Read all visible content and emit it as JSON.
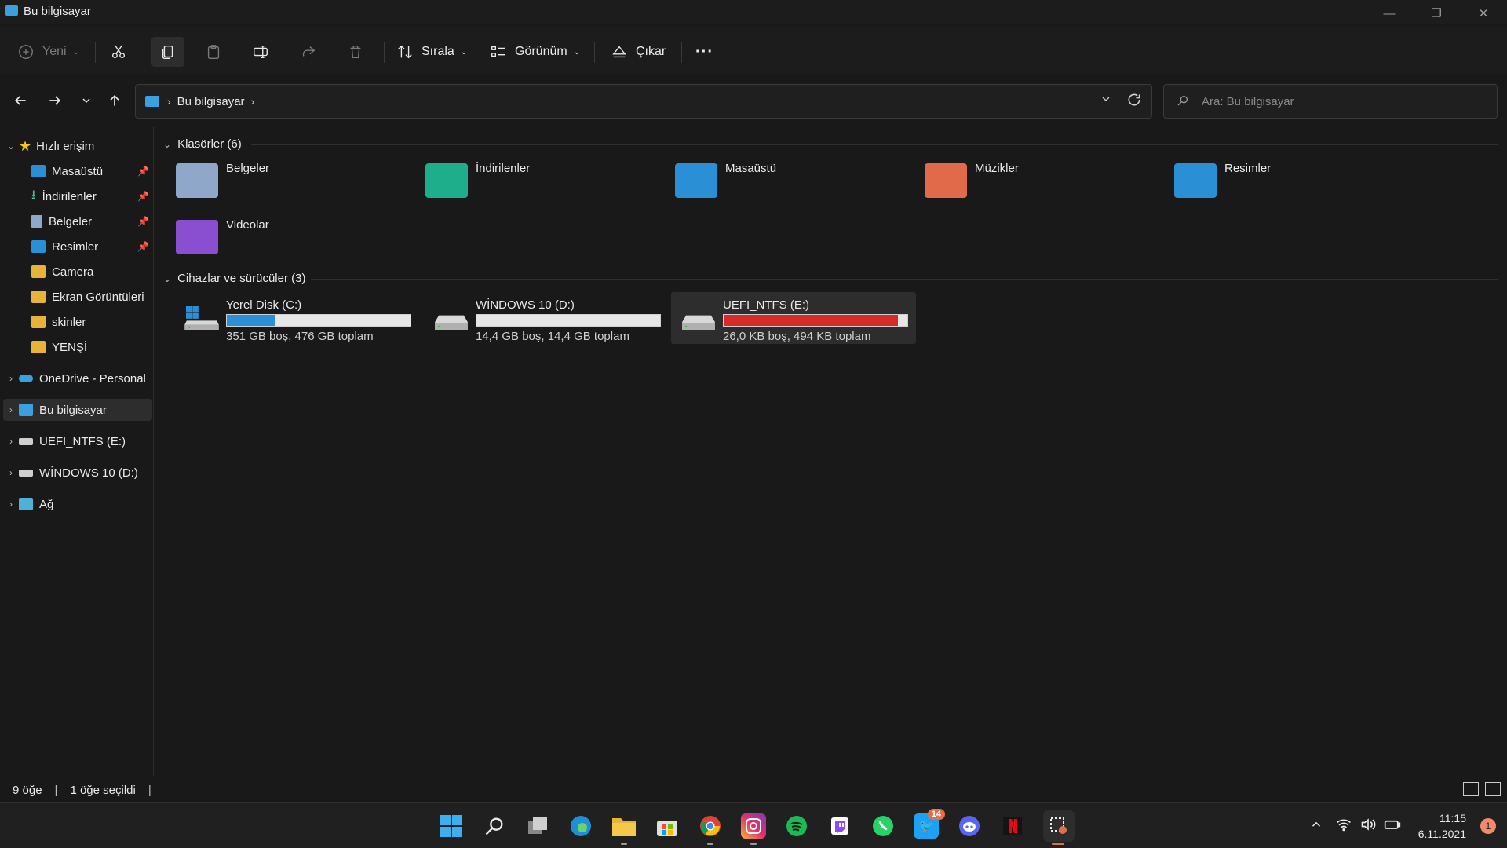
{
  "window": {
    "title": "Bu bilgisayar"
  },
  "window_controls": {
    "minimize": "—",
    "maximize": "❐",
    "close": "✕"
  },
  "toolbar": {
    "new_label": "Yeni",
    "sort_label": "Sırala",
    "view_label": "Görünüm",
    "eject_label": "Çıkar",
    "more_label": "···"
  },
  "address": {
    "crumb": "Bu bilgisayar",
    "search_placeholder": "Ara: Bu bilgisayar"
  },
  "sidebar": {
    "quick_access": "Hızlı erişim",
    "items": [
      {
        "label": "Masaüstü",
        "pinned": true
      },
      {
        "label": "İndirilenler",
        "pinned": true
      },
      {
        "label": "Belgeler",
        "pinned": true
      },
      {
        "label": "Resimler",
        "pinned": true
      },
      {
        "label": "Camera",
        "pinned": false
      },
      {
        "label": "Ekran Görüntüleri",
        "pinned": false
      },
      {
        "label": "skinler",
        "pinned": false
      },
      {
        "label": "YENŞİ",
        "pinned": false
      }
    ],
    "onedrive": "OneDrive - Personal",
    "this_pc": "Bu bilgisayar",
    "uefi": "UEFI_NTFS (E:)",
    "windows10": "WİNDOWS 10 (D:)",
    "network": "Ağ"
  },
  "folders_section": "Klasörler (6)",
  "folders": [
    {
      "name": "Belgeler",
      "icon": "documents-folder-icon",
      "color": "#8fa7c9"
    },
    {
      "name": "İndirilenler",
      "icon": "downloads-folder-icon",
      "color": "#1fae8c"
    },
    {
      "name": "Masaüstü",
      "icon": "desktop-folder-icon",
      "color": "#2b8fd6"
    },
    {
      "name": "Müzikler",
      "icon": "music-folder-icon",
      "color": "#e06a4a"
    },
    {
      "name": "Resimler",
      "icon": "pictures-folder-icon",
      "color": "#2b8fd6"
    },
    {
      "name": "Videolar",
      "icon": "videos-folder-icon",
      "color": "#8a4fd0"
    }
  ],
  "drives_section": "Cihazlar ve sürücüler (3)",
  "drives": [
    {
      "name": "Yerel Disk (C:)",
      "info": "351 GB boş, 476 GB toplam",
      "used_fraction": 0.26,
      "color": "#2b8fd6"
    },
    {
      "name": "WİNDOWS 10 (D:)",
      "info": "14,4 GB boş, 14,4 GB toplam",
      "used_fraction": 0.0,
      "color": "#2b8fd6"
    },
    {
      "name": "UEFI_NTFS (E:)",
      "info": "26,0 KB boş, 494 KB toplam",
      "used_fraction": 0.95,
      "color": "#d92a2a"
    }
  ],
  "status": {
    "items": "9 öğe",
    "selected": "1 öğe seçildi",
    "sep": "|"
  },
  "taskbar": {
    "twitter_badge": "14",
    "time": "11:15",
    "date": "6.11.2021",
    "notifications": "1"
  }
}
